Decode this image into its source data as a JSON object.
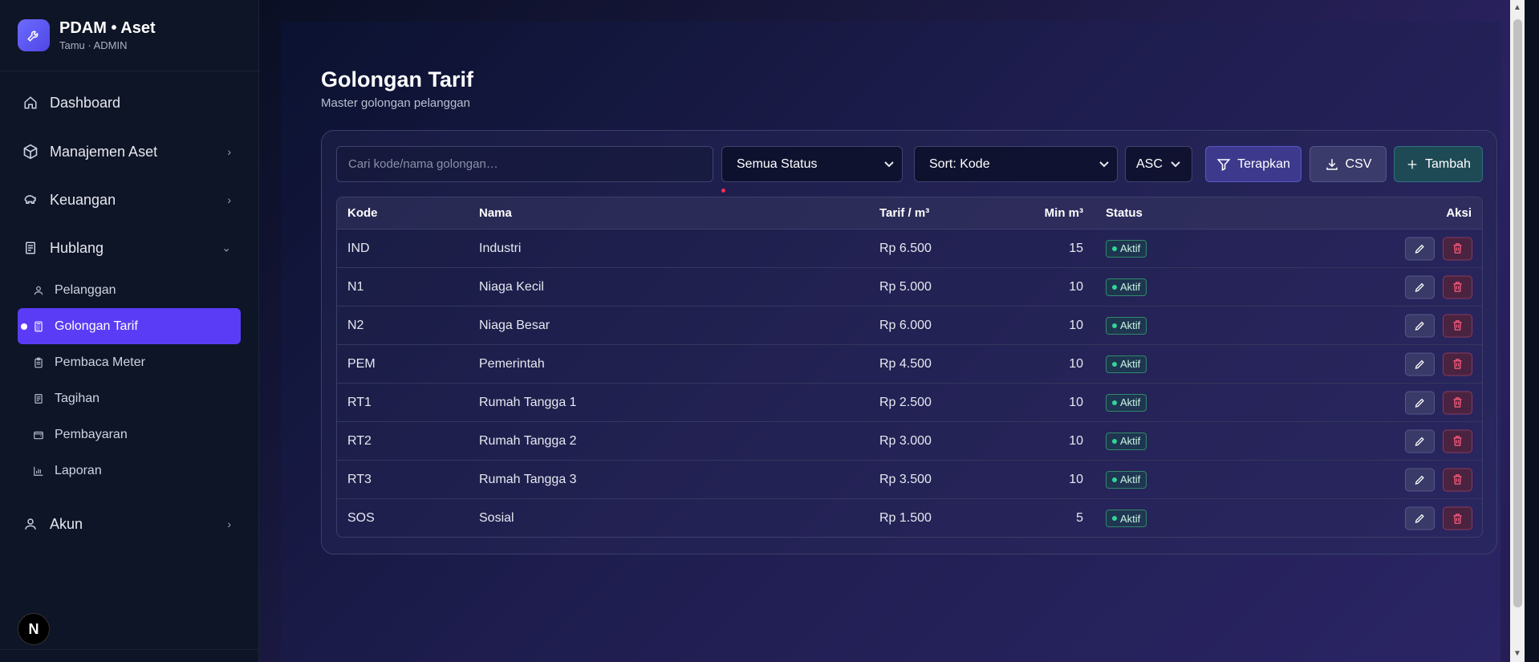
{
  "brand": {
    "title": "PDAM • Aset",
    "subtitle": "Tamu · ADMIN",
    "logo_icon": "wrench-icon"
  },
  "nav": {
    "dashboard": "Dashboard",
    "manajemen_aset": "Manajemen Aset",
    "keuangan": "Keuangan",
    "hublang": "Hublang",
    "sub_items": [
      "Pelanggan",
      "Golongan Tarif",
      "Pembaca Meter",
      "Tagihan",
      "Pembayaran",
      "Laporan"
    ],
    "akun": "Akun",
    "active": "Golongan Tarif"
  },
  "page": {
    "title": "Golongan Tarif",
    "subtitle": "Master golongan pelanggan"
  },
  "toolbar": {
    "search_placeholder": "Cari kode/nama golongan…",
    "status_select": "Semua Status",
    "sort_select": "Sort: Kode",
    "order_select": "ASC",
    "apply_label": "Terapkan",
    "csv_label": "CSV",
    "add_label": "Tambah"
  },
  "table": {
    "headers": {
      "kode": "Kode",
      "nama": "Nama",
      "tarif": "Tarif / m³",
      "min": "Min m³",
      "status": "Status",
      "aksi": "Aksi"
    },
    "rows": [
      {
        "kode": "IND",
        "nama": "Industri",
        "tarif": "Rp 6.500",
        "min": "15",
        "status": "Aktif"
      },
      {
        "kode": "N1",
        "nama": "Niaga Kecil",
        "tarif": "Rp 5.000",
        "min": "10",
        "status": "Aktif"
      },
      {
        "kode": "N2",
        "nama": "Niaga Besar",
        "tarif": "Rp 6.000",
        "min": "10",
        "status": "Aktif"
      },
      {
        "kode": "PEM",
        "nama": "Pemerintah",
        "tarif": "Rp 4.500",
        "min": "10",
        "status": "Aktif"
      },
      {
        "kode": "RT1",
        "nama": "Rumah Tangga 1",
        "tarif": "Rp 2.500",
        "min": "10",
        "status": "Aktif"
      },
      {
        "kode": "RT2",
        "nama": "Rumah Tangga 2",
        "tarif": "Rp 3.000",
        "min": "10",
        "status": "Aktif"
      },
      {
        "kode": "RT3",
        "nama": "Rumah Tangga 3",
        "tarif": "Rp 3.500",
        "min": "10",
        "status": "Aktif"
      },
      {
        "kode": "SOS",
        "nama": "Sosial",
        "tarif": "Rp 1.500",
        "min": "5",
        "status": "Aktif"
      }
    ]
  },
  "footer": {
    "next_badge": "N"
  },
  "colors": {
    "accent": "#5b3cf6",
    "status_active": "#34d399",
    "delete": "#ff5c7c"
  }
}
